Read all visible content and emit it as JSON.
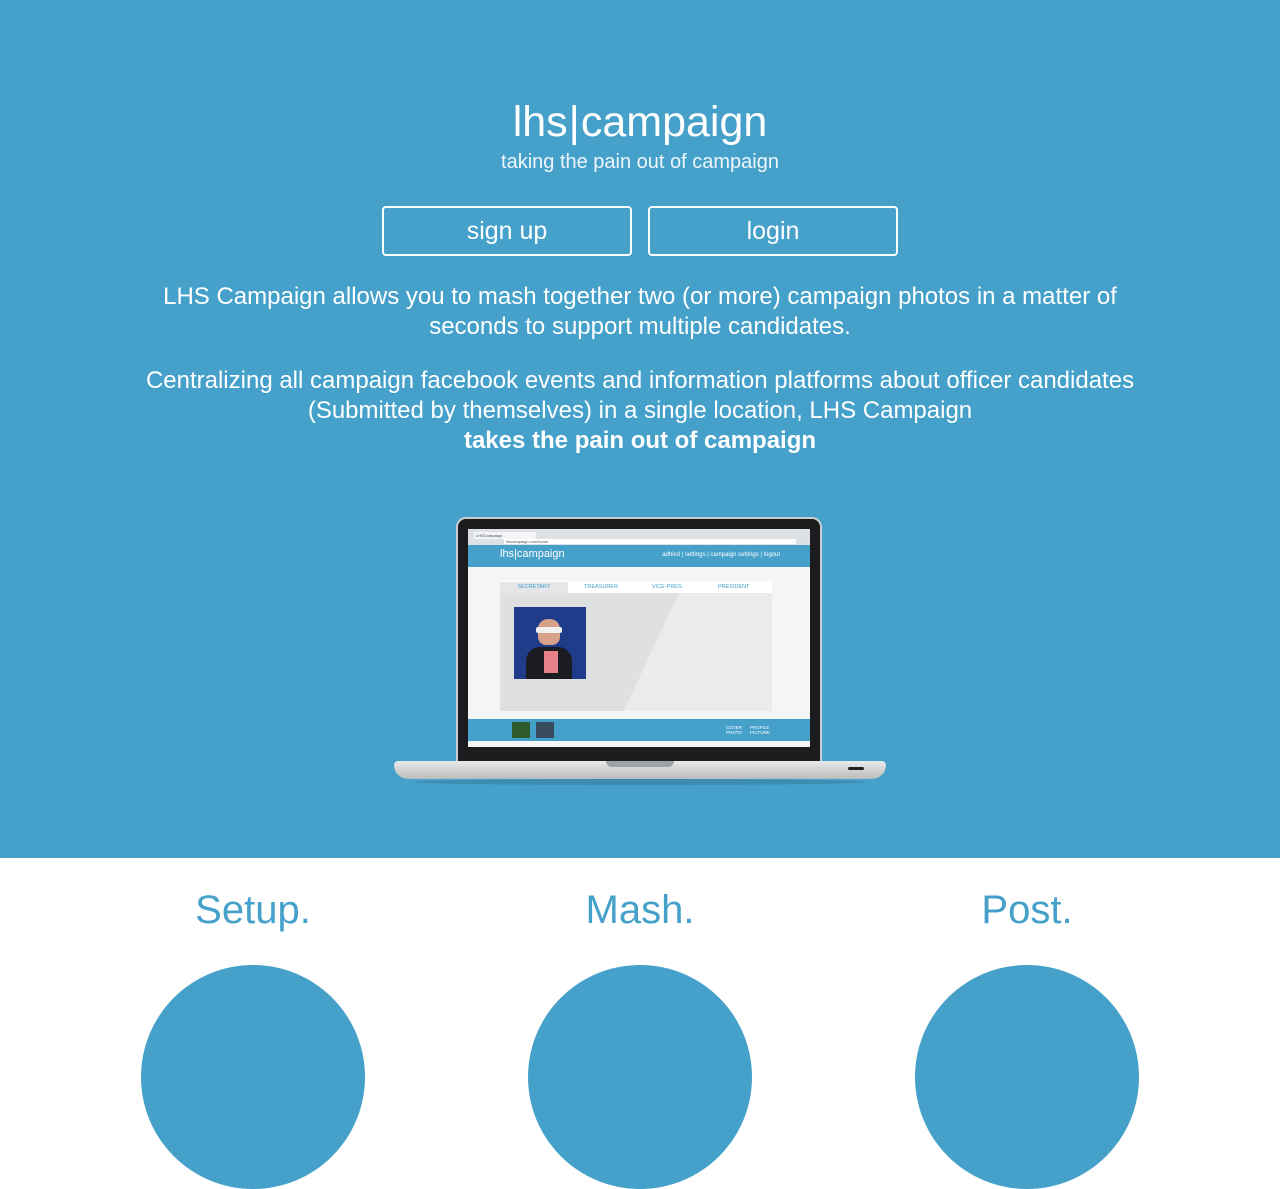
{
  "header": {
    "brand_left": "lhs",
    "brand_sep": "|",
    "brand_right": "campaign",
    "tagline": "taking the pain out of campaign"
  },
  "buttons": {
    "signup_label": "sign up",
    "login_label": "login"
  },
  "intro": {
    "paragraph1": "LHS Campaign allows you to mash together two (or more) campaign photos in a matter of seconds to support multiple candidates.",
    "paragraph2": "Centralizing all campaign facebook events and information platforms about officer candidates (Submitted by themselves) in a single location, LHS Campaign",
    "paragraph2_strong": "takes the pain out of campaign"
  },
  "mockup": {
    "tab_title": "LHSCampaign",
    "url": "lhscampaign.com/home",
    "logo": "lhs|campaign",
    "menu": "adhivd | settings | campaign settings | logout",
    "tabs": [
      "SECRETARY",
      "TREASURER",
      "VICE-PRES.",
      "PRESIDENT"
    ],
    "bottom_labels": [
      "COVER PHOTO",
      "PROFILE PICTURE"
    ]
  },
  "steps": [
    {
      "title": "Setup."
    },
    {
      "title": "Mash."
    },
    {
      "title": "Post."
    }
  ],
  "colors": {
    "accent": "#45a0ca",
    "background": "#ffffff"
  }
}
